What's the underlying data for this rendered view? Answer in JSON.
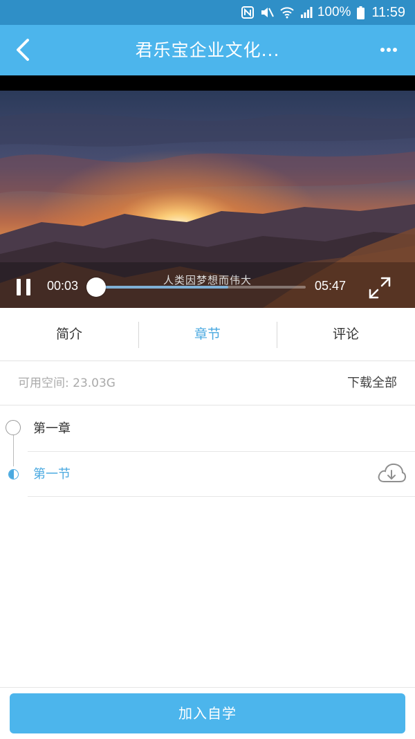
{
  "status_bar": {
    "battery_text": "100%",
    "clock": "11:59",
    "icons": [
      "nfc-icon",
      "mute-icon",
      "wifi-icon",
      "signal-icon",
      "battery-icon"
    ]
  },
  "nav": {
    "back_icon": "chevron-left-icon",
    "title": "君乐宝企业文化...",
    "more_icon": "more-dots-icon"
  },
  "video": {
    "subtitle": "人类因梦想而伟大",
    "current_time": "00:03",
    "total_time": "05:47",
    "progress_fraction": 0.009,
    "buffered_fraction": 0.64,
    "play_state_icon": "pause-icon",
    "fullscreen_icon": "fullscreen-icon"
  },
  "tabs": {
    "items": [
      {
        "label": "简介",
        "active": false
      },
      {
        "label": "章节",
        "active": true
      },
      {
        "label": "评论",
        "active": false
      }
    ]
  },
  "storage": {
    "available": "可用空间: 23.03G",
    "download_all": "下载全部"
  },
  "chapters": [
    {
      "title": "第一章",
      "sections": [
        {
          "title": "第一节",
          "download_icon": "cloud-download-icon"
        }
      ]
    }
  ],
  "bottom": {
    "join_label": "加入自学"
  },
  "colors": {
    "status_bar": "#2f8fc7",
    "nav_bar": "#4cb5ec",
    "accent": "#4aa9e0"
  }
}
